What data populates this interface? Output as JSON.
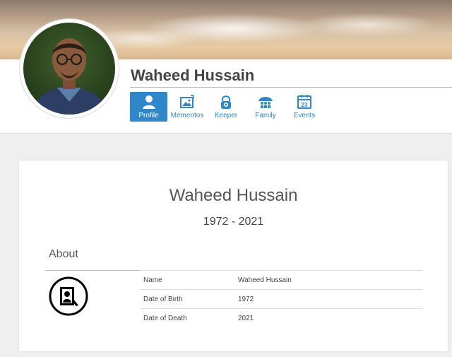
{
  "profile": {
    "name": "Waheed Hussain"
  },
  "tabs": [
    {
      "label": "Profile",
      "icon": "person-icon",
      "active": true
    },
    {
      "label": "Mementos",
      "icon": "image-icon",
      "active": false
    },
    {
      "label": "Keeper",
      "icon": "lock-icon",
      "active": false
    },
    {
      "label": "Family",
      "icon": "family-icon",
      "active": false
    },
    {
      "label": "Events",
      "icon": "calendar-icon",
      "calendar_day": "23",
      "active": false
    }
  ],
  "card": {
    "title": "Waheed Hussain",
    "years": "1972 - 2021",
    "about_heading": "About",
    "rows": [
      {
        "label": "Name",
        "value": "Waheed Hussain"
      },
      {
        "label": "Date of Birth",
        "value": "1972"
      },
      {
        "label": "Date of Death",
        "value": "2021"
      }
    ]
  },
  "colors": {
    "accent": "#2f86c8",
    "background": "#efefef"
  }
}
